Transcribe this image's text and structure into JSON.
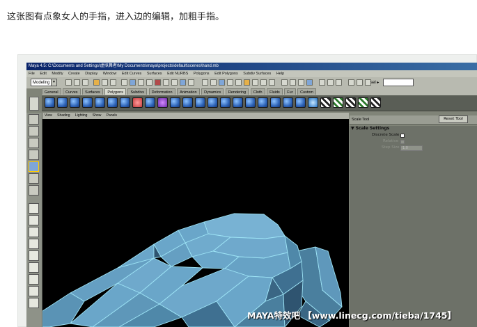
{
  "caption": "这张图有点象女人的手指，进入边的编辑，加粗手指。",
  "window": {
    "title": "Maya 4.5: C:\\Documents and Settings\\虚拟舞者\\My Documents\\maya\\projects\\default\\scenes\\hand.mb"
  },
  "menubar": [
    "File",
    "Edit",
    "Modify",
    "Create",
    "Display",
    "Window",
    "Edit Curves",
    "Surfaces",
    "Edit NURBS",
    "Polygons",
    "Edit Polygons",
    "Subdiv Surfaces",
    "Help"
  ],
  "status_line": {
    "mode": "Modeling",
    "mode_arrow": "▼",
    "sel_label": "sel ▸"
  },
  "shelf_tabs": [
    "General",
    "Curves",
    "Surfaces",
    "Polygons",
    "Subdivs",
    "Deformation",
    "Animation",
    "Dynamics",
    "Rendering",
    "Cloth",
    "Fluids",
    "Fur",
    "Custom"
  ],
  "active_shelf_tab": "Polygons",
  "panel_menu": [
    "View",
    "Shading",
    "Lighting",
    "Show",
    "Panels"
  ],
  "tool_settings": {
    "header": "Scale Tool",
    "reset_button": "Reset Tool",
    "section_toggle": "▼",
    "section": "Scale Settings",
    "discrete_scale": "Discrete Scale",
    "relative": "Relative",
    "step_size": "Step Size",
    "step_value": "1.0"
  },
  "watermark": "MAYA特效吧 【www.linecg.com/tieba/1745】",
  "colors": {
    "mesh_face": "#6aa6c9",
    "mesh_edge": "#9de3f5",
    "viewport_bg": "#000000"
  }
}
